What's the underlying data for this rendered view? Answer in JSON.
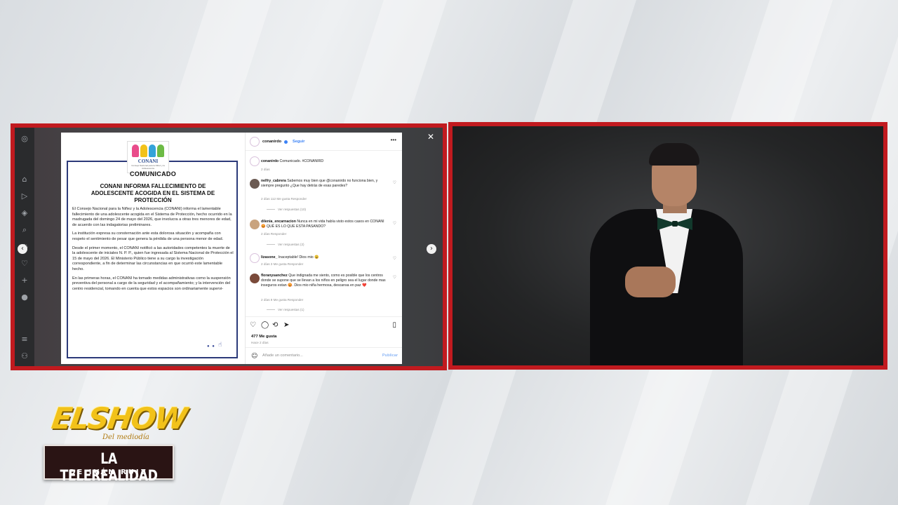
{
  "instagram": {
    "close_icon": "close-icon",
    "sidebar_icons": [
      "instagram-icon",
      "home-icon",
      "reels-icon",
      "explore-icon",
      "search-icon",
      "messenger-icon",
      "heart-icon",
      "create-icon",
      "profile-icon",
      "menu-icon",
      "meta-icon"
    ]
  },
  "post_image": {
    "logo_name": "CONANI",
    "logo_sub": "Consejo Nacional para la Niñez y la Adolescencia",
    "doc_title": "COMUNICADO",
    "headline": "CONANI INFORMA FALLECIMIENTO DE ADOLESCENTE ACOGIDA EN EL SISTEMA DE PROTECCIÓN",
    "paragraphs": [
      "El Consejo Nacional para la Niñez y la Adolescencia (CONANI) informa el lamentable fallecimiento de una adolescente acogida en el Sistema de Protección, hecho ocurrido en la madrugada del domingo 24 de mayo del 2026, que involucra a otras tres menores de edad, de acuerdo con las indagatorias preliminares.",
      "La institución expresa su consternación ante esta dolorosa situación y acompaña con respeto el sentimiento de pesar que genera la pérdida de una persona menor de edad.",
      "Desde el primer momento, el CONANI notificó a las autoridades competentes la muerte de la adolescente de iniciales N. P. P., quien fue ingresada al Sistema Nacional de Protección el 15 de mayo del 2026. El Ministerio Público tiene a su cargo la investigación correspondiente, a fin de determinar las circunstancias en que ocurrió este lamentable hecho.",
      "En las primeras horas, el CONANI ha tomado medidas administrativas como la suspensión preventiva del personal a cargo de la seguridad y el acompañamiento; y la intervención del centro residencial, tomando en cuenta que estos espacios son ordinariamente supervi-"
    ]
  },
  "post_side": {
    "username": "conanirdo",
    "follow": "Seguir",
    "caption_user": "conanirdo",
    "caption_text": "Comunicado. #CONANIRD",
    "caption_time": "2 días",
    "comments": [
      {
        "user": "nelfry_cabrera",
        "text": "Sabemos muy bien que @conanirdo no funciona bien, y siempre pregunto ¿Que hay detrás de esas paredes?",
        "meta": "2 días   112 Me gusta   Responder",
        "replies": "Ver respuestas (10)"
      },
      {
        "user": "dilenia_encarnacion",
        "text": "Nunca en mi vida había visto estos casos en CONANI 😡 QUÉ ES LO QUE ESTA PASANDO?",
        "meta": "2 días   Responder",
        "replies": "Ver respuestas (2)"
      },
      {
        "user": "lizasone_",
        "text": "Inaceptable! Dios mio 😩",
        "meta": "2 días   3 Me gusta   Responder",
        "replies": ""
      },
      {
        "user": "floranysanchez",
        "text": "Que indignada me siento, como es posible que los centros donde se supone que se llevan a los niños en peligro sea el lugar donde mas inseguros estan 😡. Dios mio niña hermosa, descansa en paz ❤️",
        "meta": "2 días   9 Me gusta   Responder",
        "replies": "Ver respuestas (1)"
      }
    ],
    "likes": "477 Me gusta",
    "ago": "Hace 2 días",
    "comment_placeholder": "Añade un comentario...",
    "publish": "Publicar"
  },
  "branding": {
    "show_title": "ELSHOW",
    "show_sub": "Del mediodía",
    "tele_title": "LA TELEREALIDAD",
    "tele_sub": "DE IVÁN RUIZ"
  },
  "colors": {
    "frame_red": "#c11a1f",
    "link_blue": "#3b82f6",
    "logo_gold": "#f2c21a"
  }
}
